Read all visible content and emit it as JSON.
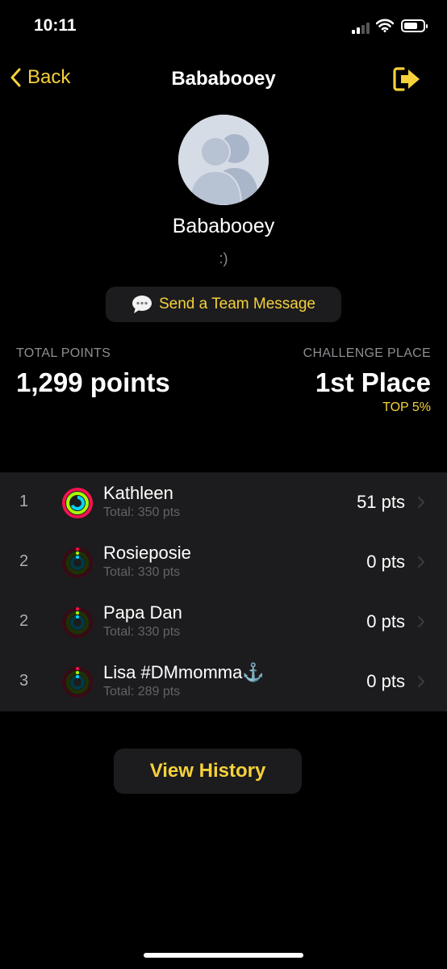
{
  "status_bar": {
    "time": "10:11"
  },
  "nav": {
    "back_label": "Back",
    "title": "Bababooey"
  },
  "team": {
    "name": "Bababooey",
    "motto": ":)"
  },
  "message_button": {
    "icon": "speech-bubble-icon",
    "label": "Send a Team Message"
  },
  "stats": {
    "total_points_label": "TOTAL POINTS",
    "total_points_value": "1,299 points",
    "challenge_place_label": "CHALLENGE PLACE",
    "challenge_place_value": "1st Place",
    "top_percent": "TOP 5%"
  },
  "members": [
    {
      "rank": "1",
      "name": "Kathleen",
      "total": "Total: 350 pts",
      "points": "51 pts",
      "ring_state": "active"
    },
    {
      "rank": "2",
      "name": "Rosieposie",
      "total": "Total: 330 pts",
      "points": "0 pts",
      "ring_state": "empty"
    },
    {
      "rank": "2",
      "name": "Papa Dan",
      "total": "Total: 330 pts",
      "points": "0 pts",
      "ring_state": "empty"
    },
    {
      "rank": "3",
      "name": "Lisa #DMmomma⚓️",
      "total": "Total: 289 pts",
      "points": "0 pts",
      "ring_state": "empty"
    }
  ],
  "history_button": {
    "label": "View History"
  },
  "colors": {
    "accent": "#f5d13a",
    "background": "#000000",
    "card": "#1c1c1e",
    "move_ring": "#fa114f",
    "exercise_ring": "#a6ff00",
    "stand_ring": "#00d7ff"
  }
}
